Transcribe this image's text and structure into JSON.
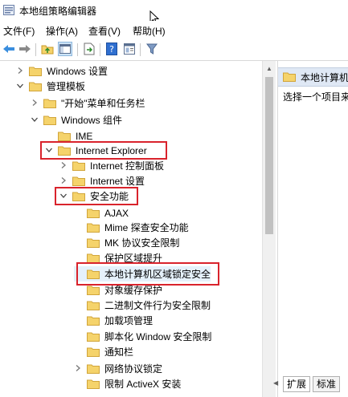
{
  "window": {
    "title": "本地组策略编辑器"
  },
  "menu": [
    "文件(F)",
    "操作(A)",
    "查看(V)",
    "帮助(H)"
  ],
  "toolbar": [
    "back-icon",
    "forward-icon",
    "up-folder-icon",
    "show-hide-tree-icon",
    "export-list-icon",
    "help-icon",
    "properties-icon",
    "filter-icon"
  ],
  "tree": [
    "Windows 设置",
    "管理模板",
    "\"开始\"菜单和任务栏",
    "Windows 组件",
    "IME",
    "Internet Explorer",
    "Internet 控制面板",
    "Internet 设置",
    "安全功能",
    "AJAX",
    "Mime 探查安全功能",
    "MK 协议安全限制",
    "保护区域提升",
    "本地计算机区域锁定安全",
    "对象缓存保护",
    "二进制文件行为安全限制",
    "加载项管理",
    "脚本化 Window 安全限制",
    "通知栏",
    "网络协议锁定",
    "限制 ActiveX 安装"
  ],
  "right_pane": {
    "header": "本地计算机",
    "description": "选择一个项目来"
  },
  "tabs": [
    "扩展",
    "标准"
  ],
  "colors": {
    "highlight_box": "#d9232c",
    "folder": "#f5d36b"
  }
}
